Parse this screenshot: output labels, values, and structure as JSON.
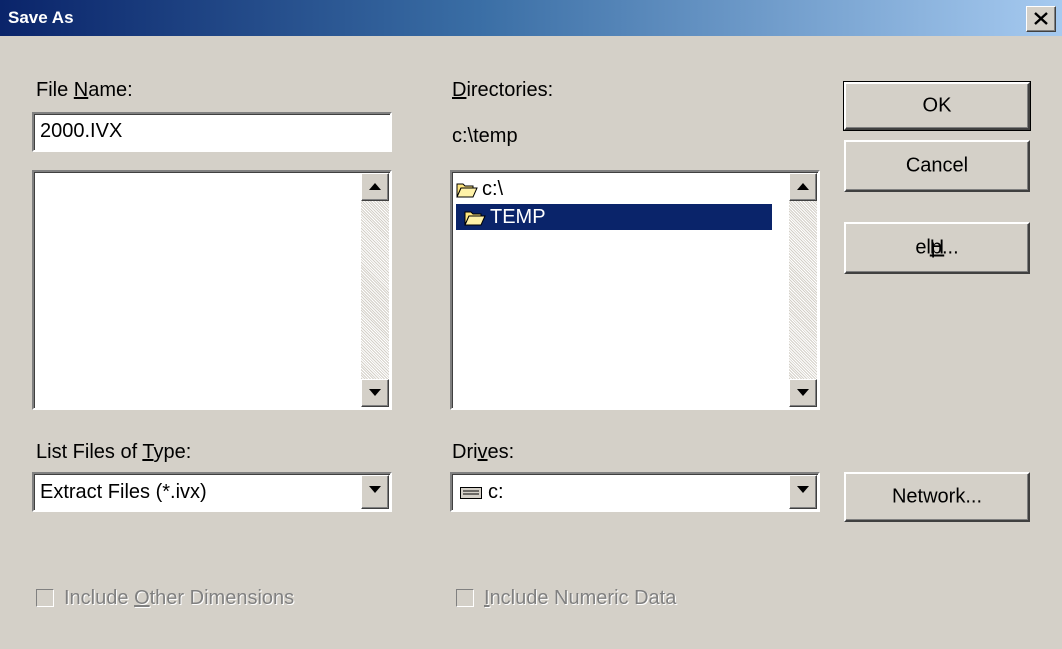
{
  "window": {
    "title": "Save As",
    "close_icon": "close-icon"
  },
  "file_name": {
    "label_prefix": "File ",
    "label_accel": "N",
    "label_suffix": "ame:",
    "value": "2000.IVX",
    "list_items": []
  },
  "directories": {
    "label_accel": "D",
    "label_suffix": "irectories:",
    "current_path": "c:\\temp",
    "items": [
      {
        "label": "c:\\",
        "icon": "open-folder-icon",
        "selected": false
      },
      {
        "label": "TEMP",
        "icon": "open-folder-icon",
        "selected": true
      }
    ]
  },
  "buttons": {
    "ok": "OK",
    "cancel": "Cancel",
    "help_accel": "H",
    "help_suffix": "elp...",
    "network": "Network..."
  },
  "file_type": {
    "label_prefix": "List Files of ",
    "label_accel": "T",
    "label_suffix": "ype:",
    "value": "Extract Files (*.ivx)"
  },
  "drives": {
    "label_prefix": "Dri",
    "label_accel": "v",
    "label_suffix": "es:",
    "value": "c:",
    "icon": "drive-icon"
  },
  "options": {
    "include_other_dimensions": {
      "prefix": "Include ",
      "accel": "O",
      "suffix": "ther Dimensions",
      "checked": false,
      "enabled": false
    },
    "include_numeric_data": {
      "prefix": "",
      "accel": "I",
      "suffix": "nclude Numeric Data",
      "checked": false,
      "enabled": false
    }
  },
  "colors": {
    "title_start": "#0a246a",
    "title_end": "#a6caf0",
    "face": "#d4d0c8",
    "selection": "#0a246a"
  }
}
